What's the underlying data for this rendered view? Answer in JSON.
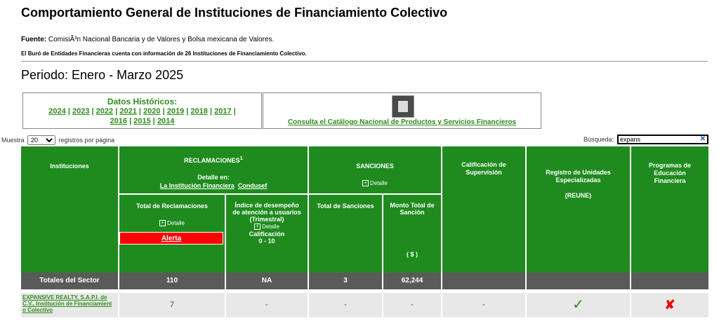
{
  "page": {
    "title": "Comportamiento General de Instituciones de Financiamiento Colectivo",
    "fuente_label": "Fuente:",
    "fuente_text": " ComisiÃ³n Nacional Bancaria y de Valores y Bolsa mexicana de Valores.",
    "buro_text": "El Buró de Entidades Financieras cuenta con información de 26 Instituciones de Financiamiento Colectivo.",
    "periodo": "Periodo: Enero - Marzo 2025"
  },
  "historicos": {
    "title": "Datos Históricos:",
    "years": [
      "2024",
      "2023",
      "2022",
      "2021",
      "2020",
      "2019",
      "2018",
      "2017",
      "2016",
      "2015",
      "2014"
    ]
  },
  "catalogo": {
    "link": "Consulta el Catálogo Nacional de Productos y Servicios Financieros",
    "icon": "book-icon"
  },
  "controls": {
    "muestra_label": "Muestra",
    "page_size": "20",
    "per_page_label": "registros por página",
    "search_label": "Búsqueda:",
    "search_value": "expans"
  },
  "table": {
    "h_instituciones": "Instituciones",
    "h_reclamaciones": "RECLAMACIONES",
    "h_reclamaciones_sup": "1",
    "h_detalle_en": "Detalle en:",
    "h_link_institucion": "La Institución Financiera",
    "h_link_condusef": "Condusef",
    "h_sanciones": "SANCIONES",
    "h_detalle": "Detalle",
    "h_calificacion": "Calificación de Supervisión",
    "h_reune": "Registro de Unidades Especializadas",
    "h_reune_abbr": "(REUNE)",
    "h_programas": "Programas de Educación Financiera",
    "h_total_reclamaciones": "Total de Reclamaciones",
    "h_alerta": "Alerta",
    "h_indice_title": "Índice de desempeño de atención a usuarios (Trimestral)",
    "h_indice_calif": "Calificación",
    "h_indice_range": "0 - 10",
    "h_total_sanciones": "Total de Sanciones",
    "h_monto": "Monto Total de Sanción",
    "h_monto_unit": "( $ )",
    "totales_label": "Totales del Sector",
    "totales": {
      "reclamaciones": "110",
      "indice": "NA",
      "sanciones": "3",
      "monto": "62,244"
    },
    "row": {
      "institucion": "EXPANSIVE REALTY, S.A.P.I. de C.V., Institución de Financiamient o Colectivo",
      "reclamaciones": "7",
      "indice": "-",
      "sanciones": "-",
      "monto": "-",
      "calificacion": "-",
      "reune": "check-icon",
      "programas": "cross-icon"
    }
  },
  "colors": {
    "header_green": "#1f8b1f",
    "link_green": "#2e8b1a",
    "alert_red": "#ff0000",
    "totals_gray": "#5a5a5a"
  }
}
